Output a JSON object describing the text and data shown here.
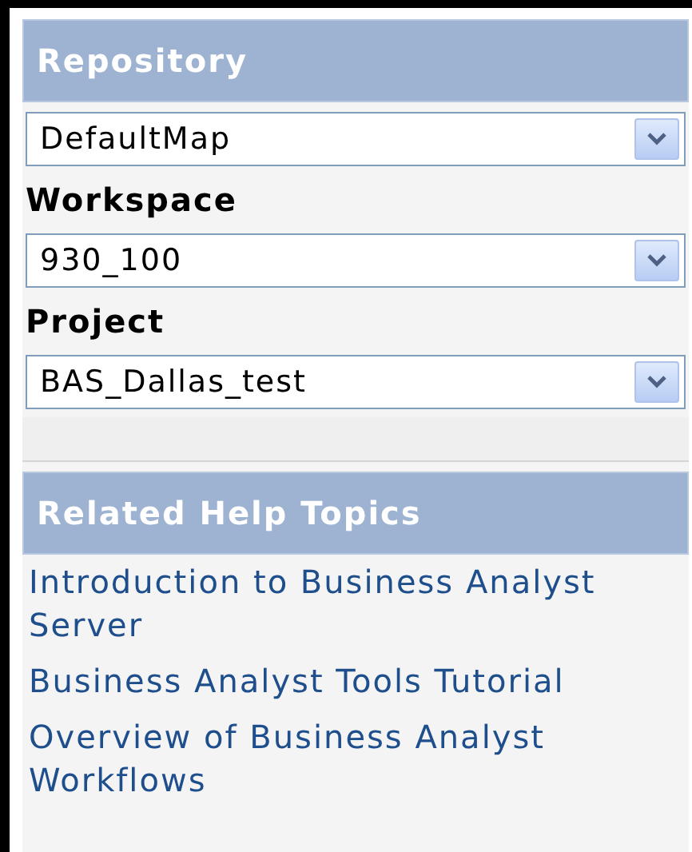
{
  "repository": {
    "title": "Repository",
    "fields": [
      {
        "value": "DefaultMap"
      },
      {
        "label": "Workspace",
        "value": "930_100"
      },
      {
        "label": "Project",
        "value": "BAS_Dallas_test"
      }
    ]
  },
  "help": {
    "title": "Related Help Topics",
    "links": [
      "Introduction to Business Analyst Server",
      "Business Analyst Tools Tutorial",
      "Overview of Business Analyst Workflows"
    ]
  }
}
